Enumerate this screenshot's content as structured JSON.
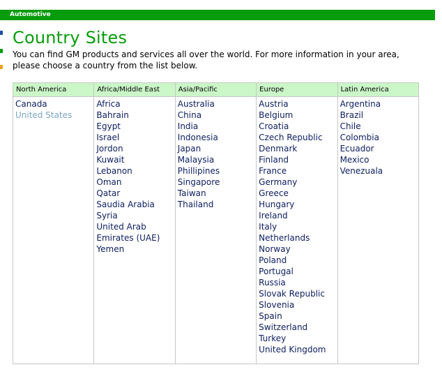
{
  "header": {
    "label": "Automotive",
    "color": "#079c0b"
  },
  "page": {
    "title": "Country Sites",
    "intro": "You can find GM products and services all over the world. For more information in your area, please choose a country from the list below."
  },
  "colors": {
    "green": "#079c0b",
    "header_bg": "#cbf7c8",
    "link": "#0c1d60",
    "link_visited": "#79a6c4",
    "edge_blue": "#1f4fa8",
    "edge_green": "#079c0b",
    "edge_orange": "#f0a01e"
  },
  "regions": [
    {
      "name": "North America",
      "countries": [
        "Canada",
        "United States"
      ],
      "highlighted": [
        "United States"
      ]
    },
    {
      "name": "Africa/Middle East",
      "countries": [
        "Africa",
        "Bahrain",
        "Egypt",
        "Israel",
        "Jordon",
        "Kuwait",
        "Lebanon",
        "Oman",
        "Qatar",
        "Saudia Arabia",
        "Syria",
        "United Arab",
        "Emirates (UAE)",
        "Yemen"
      ],
      "highlighted": []
    },
    {
      "name": "Asia/Pacific",
      "countries": [
        "Australia",
        "China",
        "India",
        "Indonesia",
        "Japan",
        "Malaysia",
        "Phillipines",
        "Singapore",
        "Taiwan",
        "Thailand"
      ],
      "highlighted": []
    },
    {
      "name": "Europe",
      "countries": [
        "Austria",
        "Belgium",
        "Croatia",
        "Czech Republic",
        "Denmark",
        "Finland",
        "France",
        "Germany",
        "Greece",
        "Hungary",
        "Ireland",
        "Italy",
        "Netherlands",
        "Norway",
        "Poland",
        "Portugal",
        "Russia",
        "Slovak Republic",
        "Slovenia",
        "Spain",
        "Switzerland",
        "Turkey",
        "United Kingdom"
      ],
      "highlighted": []
    },
    {
      "name": "Latin America",
      "countries": [
        "Argentina",
        "Brazil",
        "Chile",
        "Colombia",
        "Ecuador",
        "Mexico",
        "Venezuala"
      ],
      "highlighted": []
    }
  ]
}
